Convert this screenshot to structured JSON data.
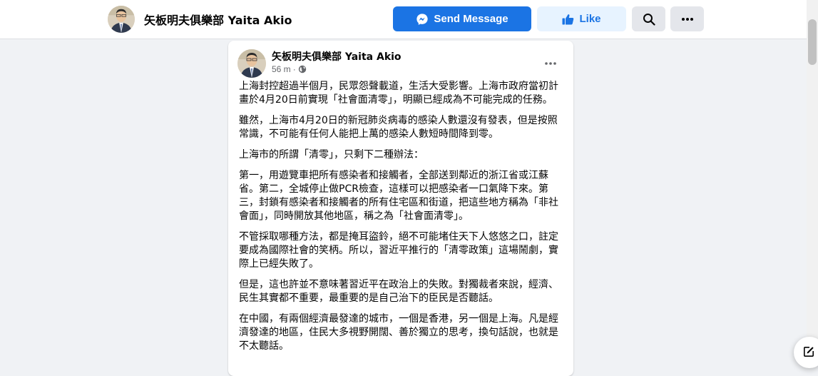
{
  "header": {
    "page_name": "矢板明夫俱樂部 Yaita Akio",
    "send_message_label": "Send Message",
    "like_label": "Like",
    "icons": {
      "messenger": "messenger-icon",
      "like": "thumbs-up-icon",
      "search": "search-icon",
      "more": "more-dots-icon"
    }
  },
  "post": {
    "author": "矢板明夫俱樂部 Yaita Akio",
    "time": "56 m",
    "separator": "·",
    "audience_icon": "globe-icon",
    "paragraphs": [
      "上海封控超過半個月，民眾怨聲載道，生活大受影響。上海市政府當初計畫於4月20日前實現「社會面清零」，明顯已經成為不可能完成的任務。",
      "雖然，上海市4月20日的新冠肺炎病毒的感染人數還沒有發表，但是按照常識，不可能有任何人能把上萬的感染人數短時間降到零。",
      "上海市的所謂「清零」，只剩下二種辦法：",
      "第一，用遊覽車把所有感染者和接觸者，全部送到鄰近的浙江省或江蘇省。第二，全城停止做PCR檢查，這樣可以把感染者一口氣降下來。第三，封鎖有感染者和接觸者的所有住宅區和街道，把這些地方稱為「非社會面」，同時開放其他地區，稱之為「社會面清零」。",
      "不管採取哪種方法，都是掩耳盜鈴，絕不可能堵住天下人悠悠之口，註定要成為國際社會的笑柄。所以，習近平推行的「清零政策」這場鬧劇，實際上已經失敗了。",
      "但是，這也許並不意味著習近平在政治上的失敗。對獨裁者來說，經濟、民生其實都不重要，最重要的是自己治下的臣民是否聽話。",
      "在中國，有兩個經濟最發達的城市，一個是香港，另一個是上海。凡是經濟發達的地區，住民大多視野開闊、善於獨立的思考，換句話說，也就是不太聽話。"
    ]
  },
  "colors": {
    "brand_blue": "#1b74e4",
    "like_bg": "#e7f3ff",
    "button_gray": "#e4e6eb",
    "page_bg": "#f0f2f5",
    "meta_gray": "#65676b"
  },
  "chat_fab_icon": "new-message-icon"
}
